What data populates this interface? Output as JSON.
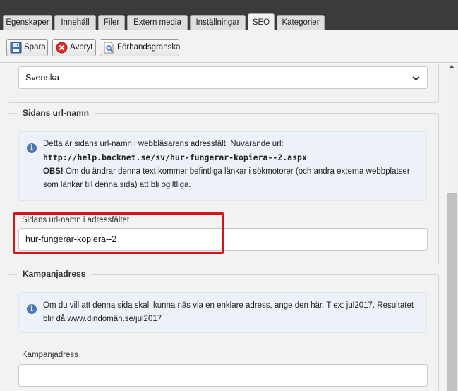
{
  "tabs": [
    {
      "label": "Egenskaper",
      "active": false
    },
    {
      "label": "Innehåll",
      "active": false
    },
    {
      "label": "Filer",
      "active": false
    },
    {
      "label": "Extern media",
      "active": false
    },
    {
      "label": "Inställningar",
      "active": false
    },
    {
      "label": "SEO",
      "active": true
    },
    {
      "label": "Kategorier",
      "active": false
    }
  ],
  "toolbar": {
    "save_label": "Spara",
    "cancel_label": "Avbryt",
    "preview_label": "Förhandsgranska"
  },
  "language": {
    "selected": "Svenska"
  },
  "url_section": {
    "legend": "Sidans url-namn",
    "info_text_1": "Detta är sidans url-namn i webbläsarens adressfält. Nuvarande url: ",
    "info_url": "http://help.backnet.se/sv/hur-fungerar-kopiera--2.aspx",
    "info_obs": "OBS!",
    "info_text_2": " Om du ändrar denna text kommer befintliga länkar i sökmotorer (och andra externa webbplatser som länkar till denna sida) att bli ogiltliga.",
    "field_label": "Sidans url-namn i adressfältet",
    "field_value": "hur-fungerar-kopiera--2"
  },
  "campaign_section": {
    "legend": "Kampanjadress",
    "info_text": "Om du vill att denna sida skall kunna nås via en enklare adress, ange den här. T ex: jul2017. Resultatet blir då www.dindomän.se/jul2017",
    "field_label": "Kampanjadress",
    "field_value": ""
  },
  "colors": {
    "tabbar": "#3b3b3b",
    "highlight": "#d4141c",
    "info_icon": "#4a79b5"
  }
}
